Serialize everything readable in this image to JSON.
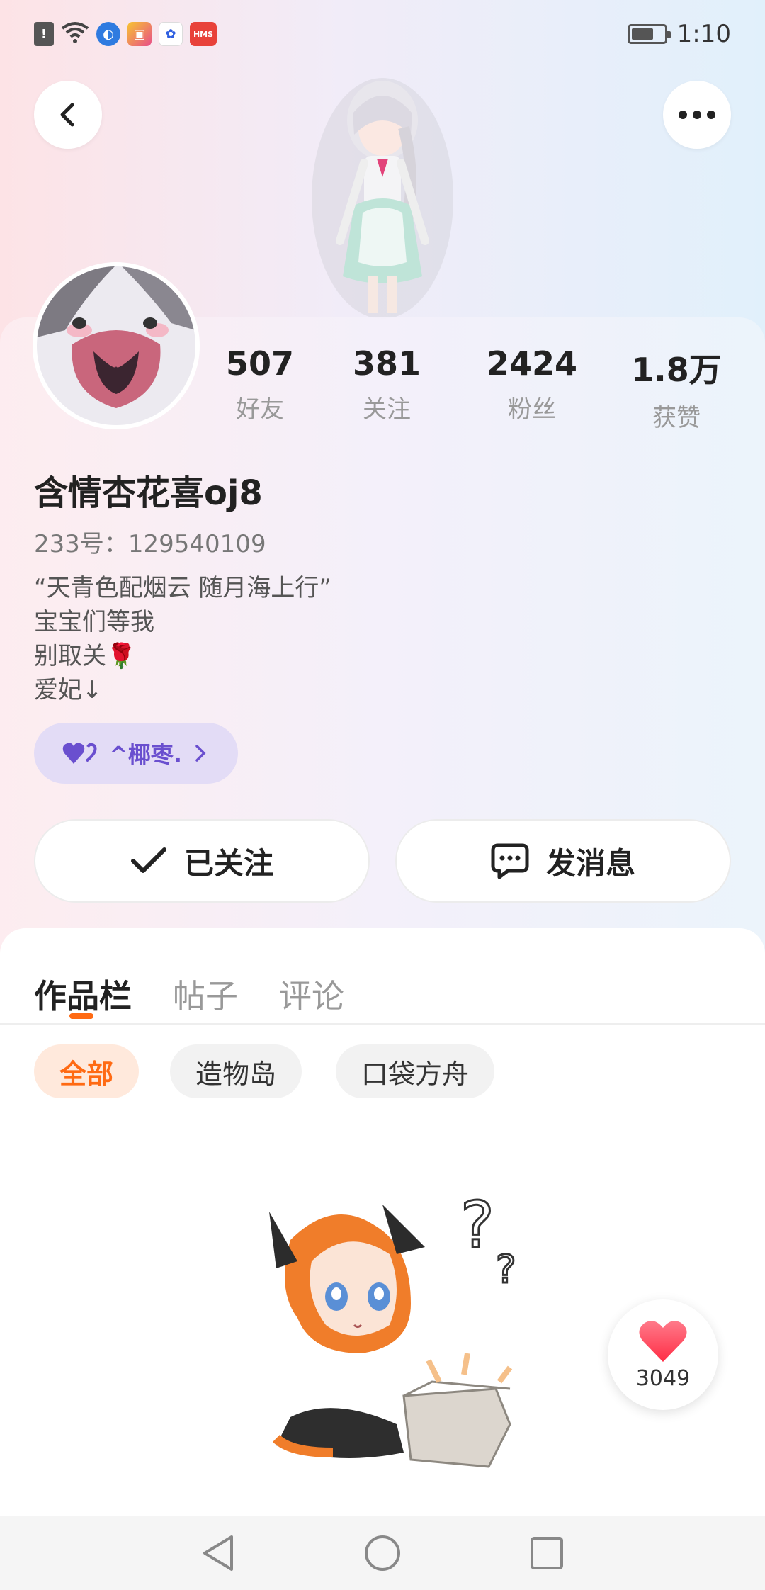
{
  "status_bar": {
    "time": "1:10",
    "icons": [
      "alert-icon",
      "wifi-icon",
      "browser-icon",
      "app-icon",
      "baidu-icon",
      "hms-icon"
    ],
    "hms_label": "HMS"
  },
  "profile": {
    "stats": [
      {
        "value": "507",
        "label": "好友"
      },
      {
        "value": "381",
        "label": "关注"
      },
      {
        "value": "2424",
        "label": "粉丝"
      },
      {
        "value": "1.8万",
        "label": "获赞"
      }
    ],
    "username": "含情杏花喜oj8",
    "user_id": "233号：129540109",
    "bio": [
      "“天青色配烟云 随月海上行”",
      "宝宝们等我",
      "别取关🌹",
      "爱妃↓"
    ],
    "tag_label": "^椰枣."
  },
  "actions": {
    "following_label": "已关注",
    "message_label": "发消息"
  },
  "tabs": [
    {
      "label": "作品栏",
      "active": true
    },
    {
      "label": "帖子",
      "active": false
    },
    {
      "label": "评论",
      "active": false
    }
  ],
  "filters": [
    {
      "label": "全部",
      "active": true
    },
    {
      "label": "造物岛",
      "active": false
    },
    {
      "label": "口袋方舟",
      "active": false
    }
  ],
  "like_float": {
    "count": "3049"
  },
  "colors": {
    "accent": "#ff6a13",
    "tag_text": "#6a4fcf",
    "tag_bg": "#e3dcf6"
  }
}
